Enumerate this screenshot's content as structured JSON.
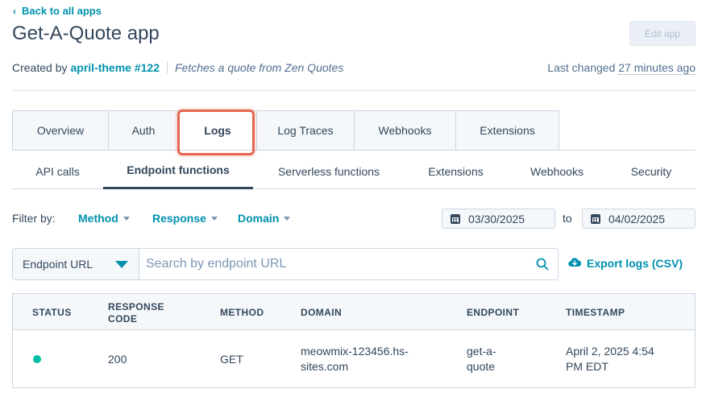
{
  "nav": {
    "back_label": "Back to all apps"
  },
  "header": {
    "title": "Get-A-Quote app",
    "edit_label": "Edit app",
    "created_by_prefix": "Created by",
    "creator": "april-theme #122",
    "description": "Fetches a quote from Zen Quotes",
    "last_changed_prefix": "Last changed",
    "last_changed_rel": "27 minutes ago"
  },
  "tabs": [
    {
      "label": "Overview"
    },
    {
      "label": "Auth"
    },
    {
      "label": "Logs"
    },
    {
      "label": "Log Traces"
    },
    {
      "label": "Webhooks"
    },
    {
      "label": "Extensions"
    }
  ],
  "subtabs": [
    {
      "label": "API calls"
    },
    {
      "label": "Endpoint functions"
    },
    {
      "label": "Serverless functions"
    },
    {
      "label": "Extensions"
    },
    {
      "label": "Webhooks"
    },
    {
      "label": "Security"
    }
  ],
  "filters": {
    "label": "Filter by:",
    "method": "Method",
    "response": "Response",
    "domain": "Domain",
    "date_from": "03/30/2025",
    "to_label": "to",
    "date_to": "04/02/2025"
  },
  "search": {
    "select_value": "Endpoint URL",
    "placeholder": "Search by endpoint URL",
    "export_label": "Export logs (CSV)"
  },
  "table": {
    "columns": {
      "status": "STATUS",
      "response_1": "RESPONSE",
      "response_2": "CODE",
      "method": "METHOD",
      "domain": "DOMAIN",
      "endpoint": "ENDPOINT",
      "timestamp": "TIMESTAMP"
    },
    "rows": [
      {
        "status_color": "#00bda5",
        "response_code": "200",
        "method": "GET",
        "domain_1": "meowmix-123456.hs-",
        "domain_2": "sites.com",
        "endpoint_1": "get-a-",
        "endpoint_2": "quote",
        "timestamp_1": "April 2, 2025 4:54",
        "timestamp_2": "PM EDT"
      }
    ]
  },
  "colors": {
    "accent": "#0091ae",
    "text": "#33475b",
    "highlight": "#e5654f",
    "success": "#00bda5"
  }
}
